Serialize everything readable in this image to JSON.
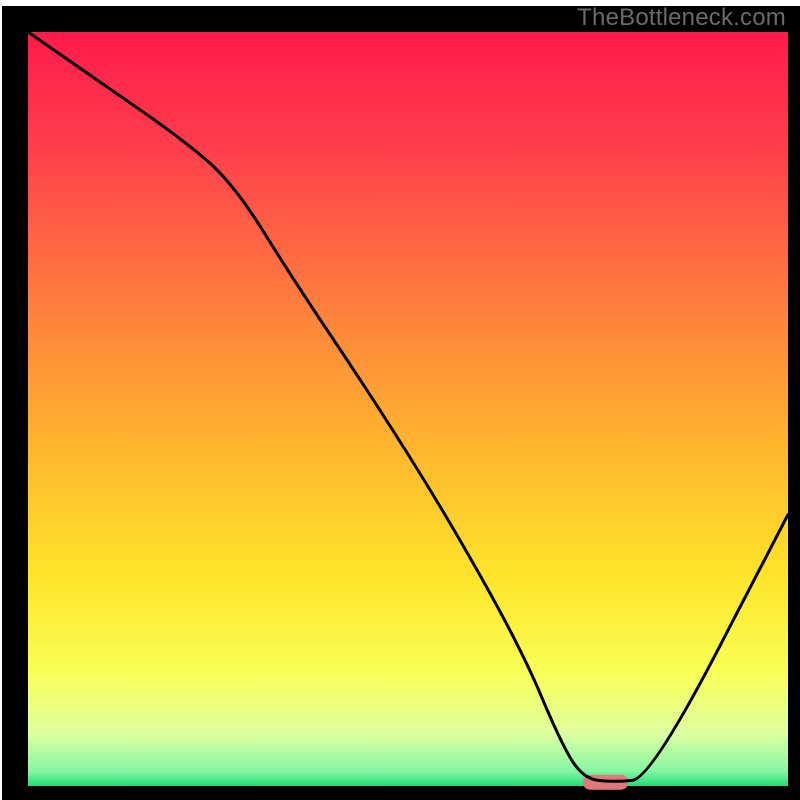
{
  "watermark": "TheBottleneck.com",
  "chart_data": {
    "type": "line",
    "title": "",
    "xlabel": "",
    "ylabel": "",
    "xlim": [
      0,
      100
    ],
    "ylim": [
      0,
      100
    ],
    "x": [
      0,
      10,
      20,
      27,
      35,
      45,
      55,
      65,
      70,
      73,
      77,
      82,
      100
    ],
    "values": [
      100,
      93,
      86,
      80,
      67,
      52,
      36,
      18,
      6,
      1,
      0.5,
      1,
      36
    ],
    "marker": {
      "x_start": 73,
      "x_end": 79,
      "y": 0.5,
      "color": "#e07a7a"
    },
    "gradient_stops": [
      {
        "offset": 0.0,
        "color": "#ff1a4b"
      },
      {
        "offset": 0.15,
        "color": "#ff3d4c"
      },
      {
        "offset": 0.35,
        "color": "#ff7b3e"
      },
      {
        "offset": 0.55,
        "color": "#ffb52e"
      },
      {
        "offset": 0.72,
        "color": "#ffe42a"
      },
      {
        "offset": 0.85,
        "color": "#f8ff55"
      },
      {
        "offset": 0.93,
        "color": "#deffa0"
      },
      {
        "offset": 0.98,
        "color": "#86f7a2"
      },
      {
        "offset": 1.0,
        "color": "#24db79"
      }
    ],
    "frame_color": "#000000",
    "line_color": "#000000",
    "line_width": 3
  }
}
